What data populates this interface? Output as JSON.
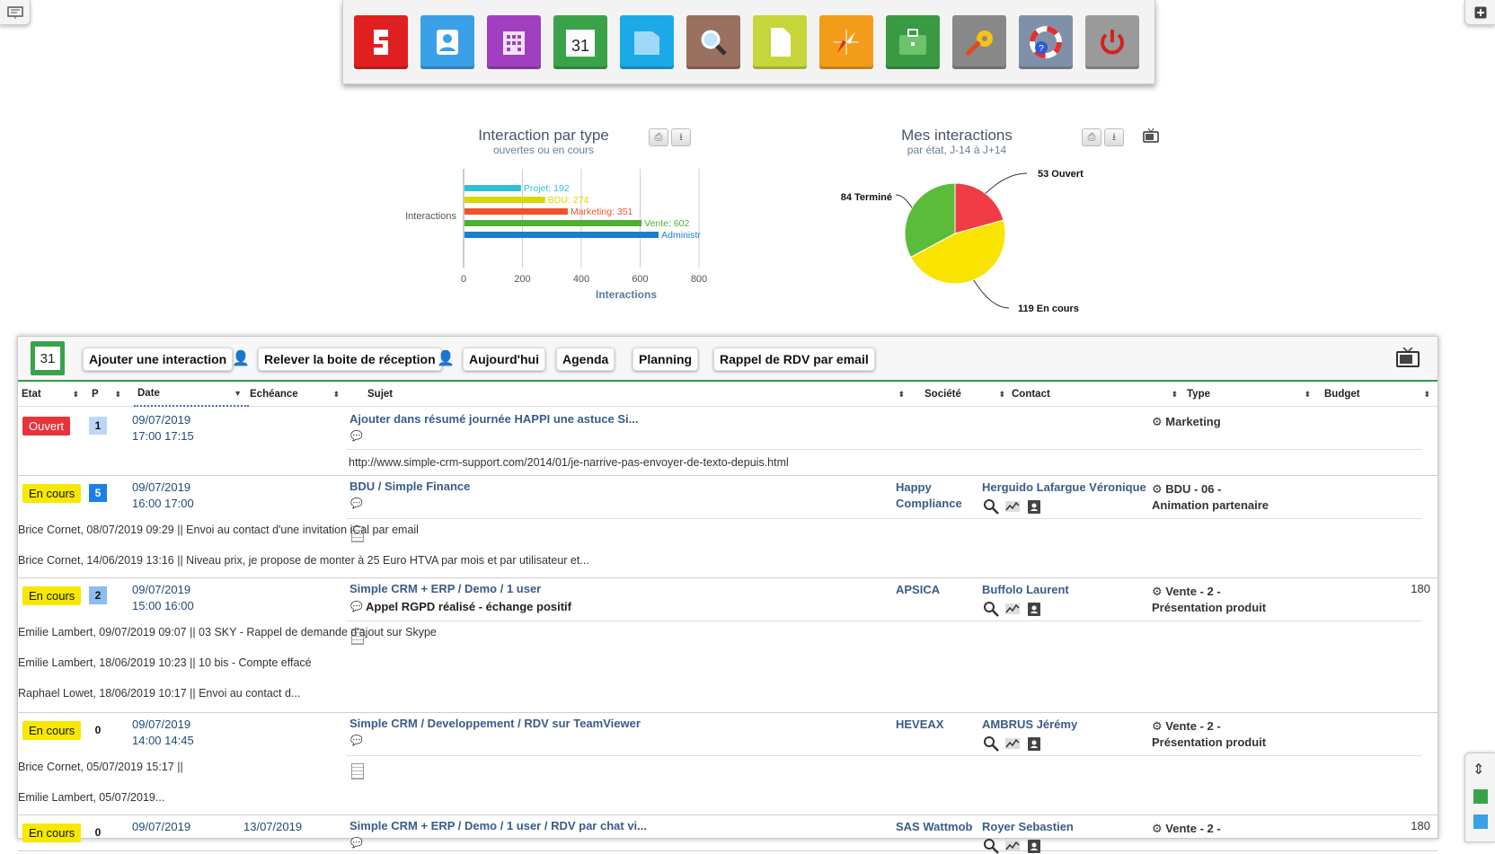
{
  "launcher": {
    "apps": [
      {
        "name": "simple-crm-icon",
        "color": "#e02020"
      },
      {
        "name": "contacts-icon",
        "color": "#3aa0e8"
      },
      {
        "name": "companies-icon",
        "color": "#a040c0"
      },
      {
        "name": "calendar-icon",
        "color": "#3aa34a",
        "label": "31"
      },
      {
        "name": "documents-icon",
        "color": "#1ba9e8"
      },
      {
        "name": "search-icon",
        "color": "#9a7060"
      },
      {
        "name": "notes-icon",
        "color": "#c6d63a"
      },
      {
        "name": "compass-icon",
        "color": "#f39c1a"
      },
      {
        "name": "briefcase-icon",
        "color": "#3a9a44"
      },
      {
        "name": "settings-icon",
        "color": "#888888"
      },
      {
        "name": "help-icon",
        "color": "#8090a8"
      },
      {
        "name": "power-icon",
        "color": "#9a9a9a"
      }
    ]
  },
  "bar_chart": {
    "title": "Interaction par type",
    "subtitle": "ouvertes ou en cours",
    "category_label": "Interactions",
    "xlabel": "Interactions"
  },
  "pie_chart": {
    "title": "Mes interactions",
    "subtitle": "par état, J-14 à J+14"
  },
  "chart_data": [
    {
      "type": "bar",
      "orientation": "horizontal",
      "title": "Interaction par type",
      "subtitle": "ouvertes ou en cours",
      "categories": [
        "Interactions"
      ],
      "xlabel": "Interactions",
      "xlim": [
        0,
        800
      ],
      "xticks": [
        0,
        200,
        400,
        600,
        800
      ],
      "series": [
        {
          "name": "Projet",
          "values": [
            192
          ],
          "color": "#2ec1d9",
          "label": "Projet: 192"
        },
        {
          "name": "BDU",
          "values": [
            274
          ],
          "color": "#d8d800",
          "label": "BDU: 274"
        },
        {
          "name": "Marketing",
          "values": [
            351
          ],
          "color": "#f0522a",
          "label": "Marketing: 351"
        },
        {
          "name": "Vente",
          "values": [
            602
          ],
          "color": "#4db030",
          "label": "Vente: 602"
        },
        {
          "name": "Administr",
          "values": [
            660
          ],
          "color": "#1a7fc8",
          "label": "Administr"
        }
      ]
    },
    {
      "type": "pie",
      "title": "Mes interactions",
      "subtitle": "par état, J-14 à J+14",
      "slices": [
        {
          "name": "Ouvert",
          "value": 53,
          "color": "#f03c44",
          "label": "53 Ouvert"
        },
        {
          "name": "En cours",
          "value": 119,
          "color": "#f8e400",
          "label": "119 En cours"
        },
        {
          "name": "Terminé",
          "value": 84,
          "color": "#5bbb3a",
          "label": "84 Terminé"
        }
      ]
    }
  ],
  "toolbar": {
    "calendar_day": "31",
    "add_interaction": "Ajouter une interaction",
    "check_inbox": "Relever la boite de réception",
    "today": "Aujourd'hui",
    "agenda": "Agenda",
    "planning": "Planning",
    "reminder": "Rappel de RDV par email"
  },
  "table": {
    "headers": {
      "etat": "Etat",
      "p": "P",
      "date": "Date",
      "echeance": "Echéance",
      "sujet": "Sujet",
      "societe": "Société",
      "contact": "Contact",
      "type": "Type",
      "budget": "Budget"
    },
    "rows": [
      {
        "etat": "Ouvert",
        "p": "1",
        "date": "09/07/2019",
        "time": "17:00  17:15",
        "echeance": "",
        "subject": "Ajouter dans résumé journée HAPPI une astuce Si...",
        "detail": "",
        "societe": "",
        "societe2": "",
        "contact": "",
        "type": "Marketing",
        "type2": "",
        "budget": "",
        "notes": [
          "http://www.simple-crm-support.com/2014/01/je-narrive-pas-envoyer-de-texto-depuis.html"
        ]
      },
      {
        "etat": "En cours",
        "p": "5",
        "date": "09/07/2019",
        "time": "16:00  17:00",
        "echeance": "",
        "subject": "BDU / Simple Finance",
        "detail": "",
        "societe": "Happy",
        "societe2": "Compliance",
        "contact": "Herguido Lafargue Véronique",
        "type": "BDU - 06 -",
        "type2": "Animation partenaire",
        "budget": "",
        "notes": [
          "Brice Cornet, 08/07/2019 09:29 || Envoi au contact d'une invitation iCal par email",
          "Brice Cornet, 14/06/2019 13:16 || Niveau prix, je propose de monter à 25 Euro HTVA par mois et par utilisateur et..."
        ]
      },
      {
        "etat": "En cours",
        "p": "2",
        "date": "09/07/2019",
        "time": "15:00  16:00",
        "echeance": "",
        "subject": "Simple CRM + ERP / Demo / 1 user",
        "detail": "Appel RGPD réalisé - échange positif",
        "societe": "APSICA",
        "societe2": "",
        "contact": "Buffolo Laurent",
        "type": "Vente - 2 -",
        "type2": "Présentation produit",
        "budget": "180",
        "notes": [
          "Emilie Lambert, 09/07/2019 09:07 || 03 SKY - Rappel de demande d'ajout sur Skype",
          "Emilie Lambert, 18/06/2019 10:23 || 10 bis - Compte effacé",
          "Raphael Lowet, 18/06/2019 10:17 || Envoi au contact d..."
        ]
      },
      {
        "etat": "En cours",
        "p": "0",
        "date": "09/07/2019",
        "time": "14:00  14:45",
        "echeance": "",
        "subject": "Simple CRM / Developpement / RDV sur TeamViewer",
        "detail": "",
        "societe": "HEVEAX",
        "societe2": "",
        "contact": "AMBRUS Jérémy",
        "type": "Vente - 2 -",
        "type2": "Présentation produit",
        "budget": "",
        "notes": [
          "Brice Cornet, 05/07/2019 15:17 ||",
          "Emilie Lambert, 05/07/2019..."
        ]
      },
      {
        "etat": "En cours",
        "p": "0",
        "date": "09/07/2019",
        "time": "",
        "echeance": "13/07/2019",
        "subject": "Simple CRM + ERP / Demo / 1 user / RDV par chat vi...",
        "detail": "",
        "societe": "SAS Wattmob",
        "societe2": "",
        "contact": "Royer Sebastien",
        "type": "Vente - 2 -",
        "type2": "",
        "budget": "180",
        "notes": []
      }
    ]
  }
}
